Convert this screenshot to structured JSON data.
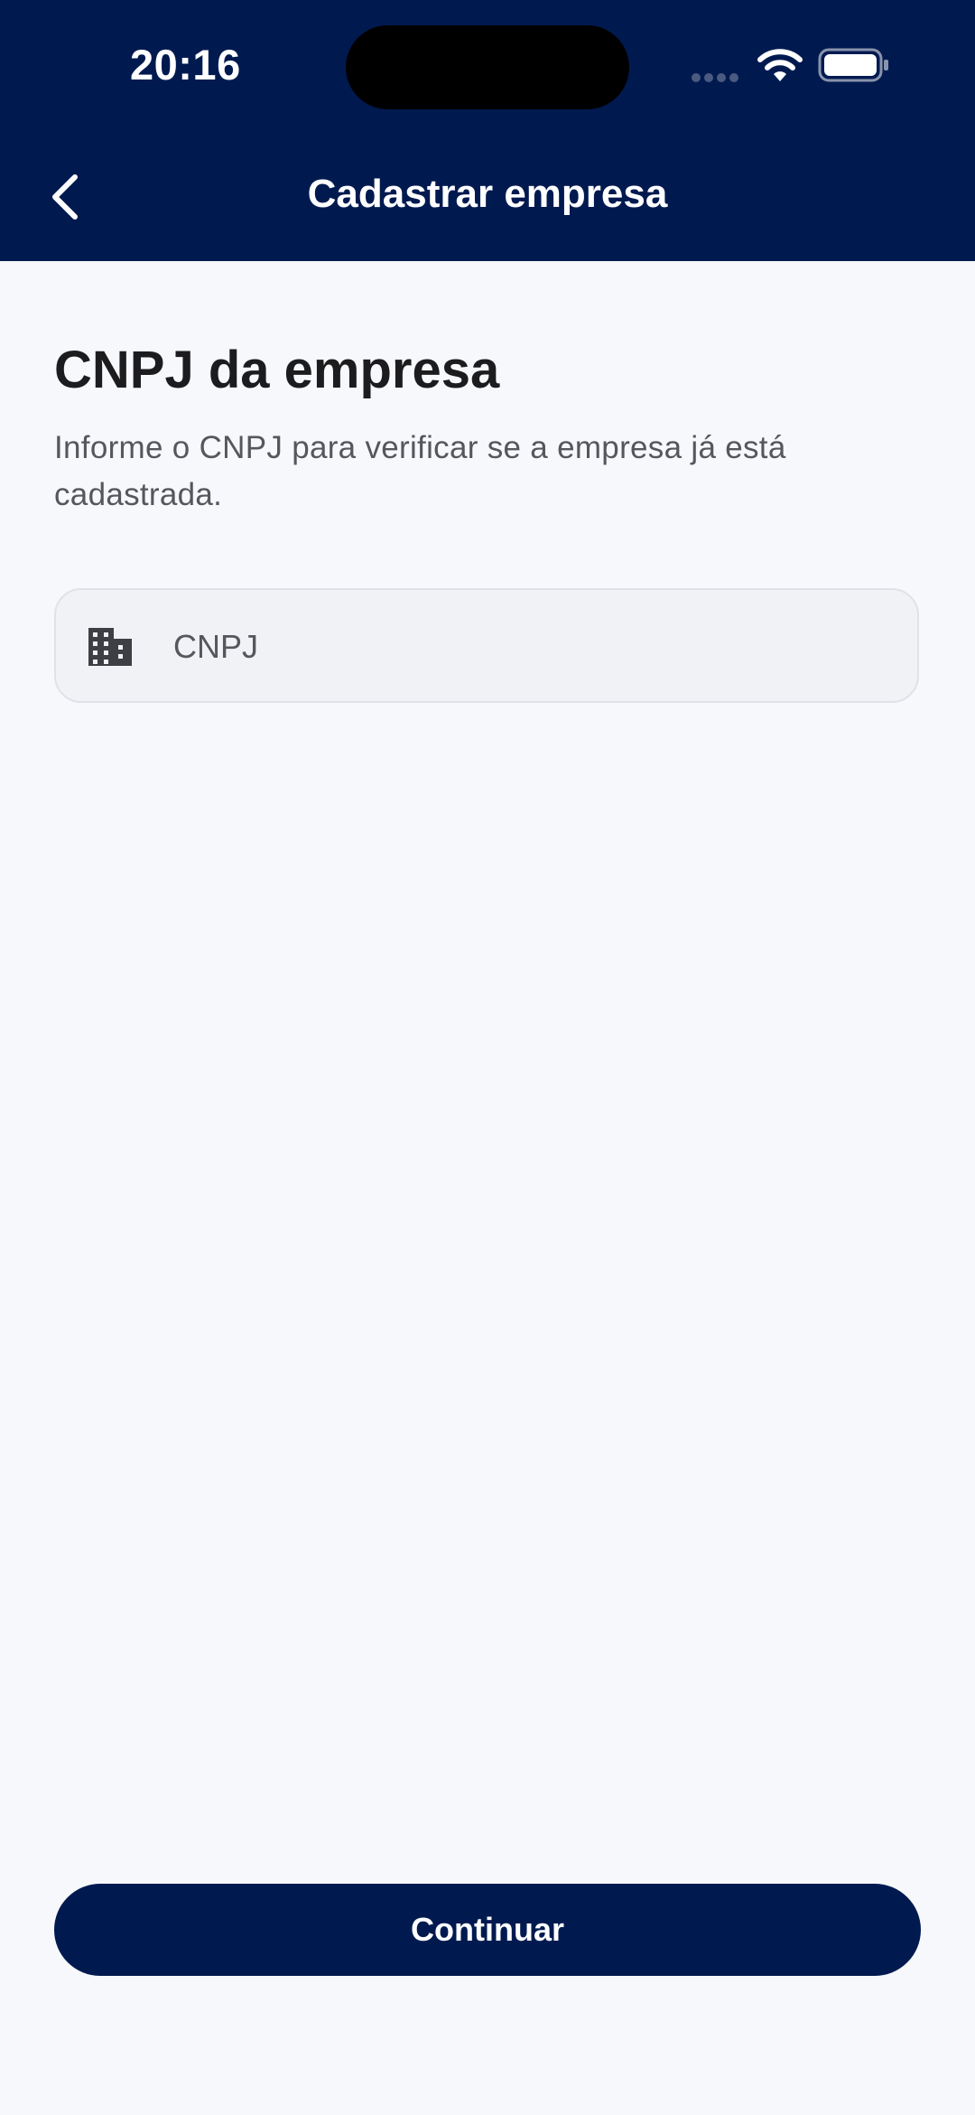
{
  "status_bar": {
    "time": "20:16"
  },
  "nav": {
    "title": "Cadastrar empresa",
    "back_icon": "chevron-left-icon"
  },
  "content": {
    "heading": "CNPJ da empresa",
    "subtext": "Informe o CNPJ para verificar se a empresa já está cadastrada."
  },
  "cnpj_field": {
    "icon": "building-icon",
    "value": "",
    "placeholder": "CNPJ"
  },
  "footer": {
    "continue_label": "Continuar"
  },
  "colors": {
    "primary": "#001A50",
    "background": "#F6F8FC",
    "field_background": "#F1F2F6",
    "text_primary": "#1C1C1E",
    "text_secondary": "#55575D"
  }
}
